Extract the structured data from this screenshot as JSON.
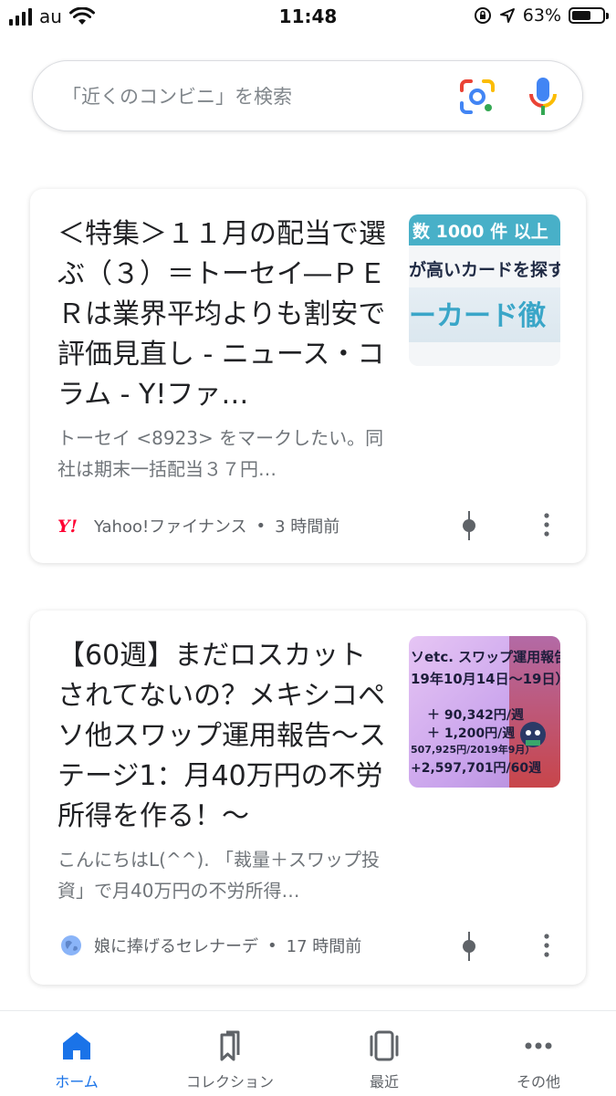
{
  "status_bar": {
    "carrier": "au",
    "time": "11:48",
    "battery": "63%",
    "battery_level": 0.63,
    "icons": [
      "signal-icon",
      "wifi-icon",
      "orientation-lock-icon",
      "location-icon",
      "battery-icon"
    ]
  },
  "search": {
    "placeholder": "「近くのコンビニ」を検索",
    "value": "",
    "icons": [
      "lens-icon",
      "mic-icon"
    ]
  },
  "feed": {
    "cards": [
      {
        "title": "＜特集＞１１月の配当で選ぶ（３）＝トーセイ―ＰＥＲは業界平均よりも割安で評価見直し - ニュース・コラム - Y!ファ…",
        "snippet": "トーセイ <8923> をマークしたい。同社は期末一括配当３７円…",
        "source": "Yahoo!ファイナンス",
        "time": "3 時間前",
        "source_icon": "yahoo-logo-icon",
        "thumbnail": {
          "line1": "数 1000 件 以上",
          "line2": "が高いカードを探す",
          "line3": "ーカード徹"
        }
      },
      {
        "title": "【60週】まだロスカットされてないの？メキシコペソ他スワップ運用報告〜ステージ1：月40万円の不労所得を作る！〜",
        "snippet": "こんにちはL(^^). 「裁量＋スワップ投資」で月40万円の不労所得…",
        "source": "娘に捧げるセレナーデ",
        "time": "17 時間前",
        "source_icon": "globe-icon",
        "thumbnail": {
          "line1": "ソetc. スワップ運用報告",
          "line2": "19年10月14日〜19日）",
          "line3": "＋ 90,342円/週",
          "line4": "＋ 1,200円/週",
          "line5": "507,925円/2019年9月）",
          "line6": "+2,597,701円/60週"
        }
      }
    ]
  },
  "bottom_nav": {
    "items": [
      {
        "label": "ホーム",
        "icon": "home-icon",
        "active": true
      },
      {
        "label": "コレクション",
        "icon": "collections-icon",
        "active": false
      },
      {
        "label": "最近",
        "icon": "recent-tabs-icon",
        "active": false
      },
      {
        "label": "その他",
        "icon": "more-horizontal-icon",
        "active": false
      }
    ]
  },
  "colors": {
    "accent": "#1a73e8",
    "text_primary": "#202124",
    "text_secondary": "#70757a",
    "yahoo_red": "#ff0033"
  }
}
